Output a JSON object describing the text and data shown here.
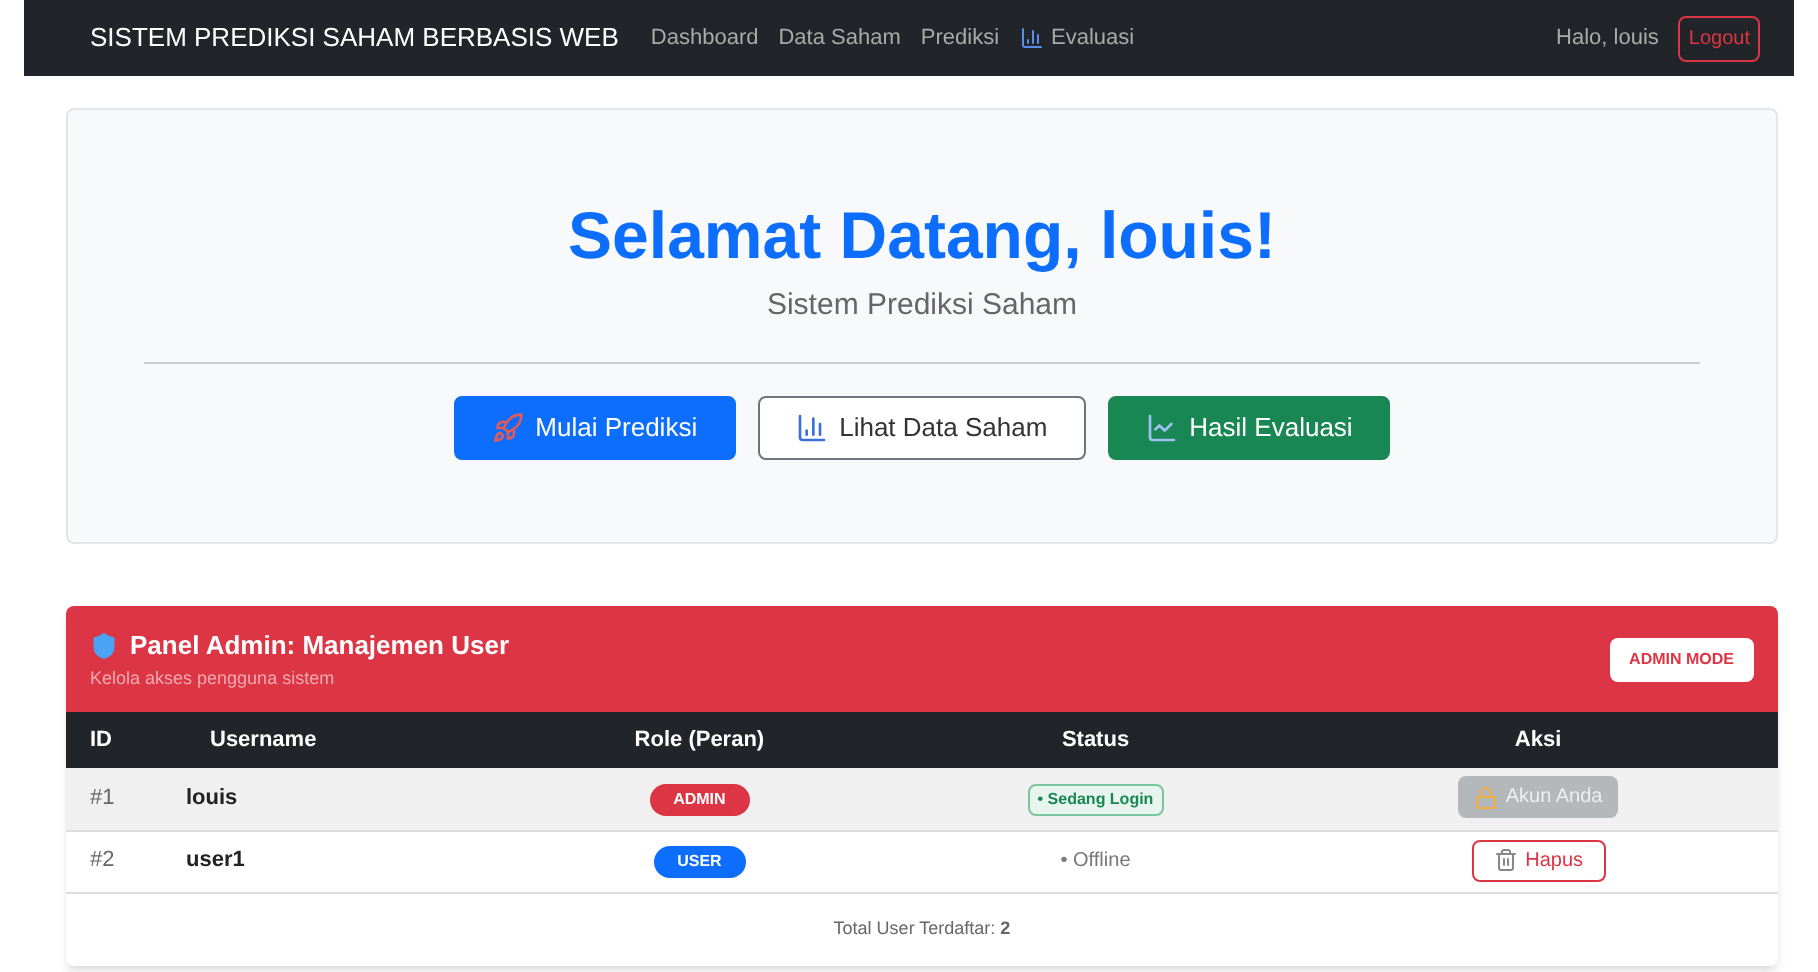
{
  "navbar": {
    "brand": "SISTEM PREDIKSI SAHAM BERBASIS WEB",
    "links": [
      {
        "label": "Dashboard",
        "icon": false
      },
      {
        "label": "Data Saham",
        "icon": false
      },
      {
        "label": "Prediksi",
        "icon": false
      },
      {
        "label": "Evaluasi",
        "icon": true
      }
    ],
    "greeting": "Halo, louis",
    "logout": "Logout"
  },
  "hero": {
    "title": "Selamat Datang, louis!",
    "subtitle": "Sistem Prediksi Saham",
    "buttons": [
      {
        "label": "Mulai Prediksi",
        "kind": "primary"
      },
      {
        "label": "Lihat Data Saham",
        "kind": "outline"
      },
      {
        "label": "Hasil Evaluasi",
        "kind": "success"
      }
    ]
  },
  "admin_panel": {
    "title": "Panel Admin: Manajemen User",
    "subtitle": "Kelola akses pengguna sistem",
    "badge": "ADMIN MODE",
    "table": {
      "columns": [
        "ID",
        "Username",
        "Role (Peran)",
        "Status",
        "Aksi"
      ],
      "rows": [
        {
          "id": "#1",
          "username": "louis",
          "role": {
            "label": "ADMIN",
            "kind": "admin"
          },
          "status": {
            "label": "• Sedang Login",
            "kind": "online"
          },
          "action": {
            "label": "Akun Anda",
            "kind": "self"
          },
          "selected": true
        },
        {
          "id": "#2",
          "username": "user1",
          "role": {
            "label": "USER",
            "kind": "user"
          },
          "status": {
            "label": "• Offline",
            "kind": "offline"
          },
          "action": {
            "label": "Hapus",
            "kind": "delete"
          },
          "selected": false
        }
      ]
    },
    "footer": "Total User Terdaftar: **2**"
  }
}
